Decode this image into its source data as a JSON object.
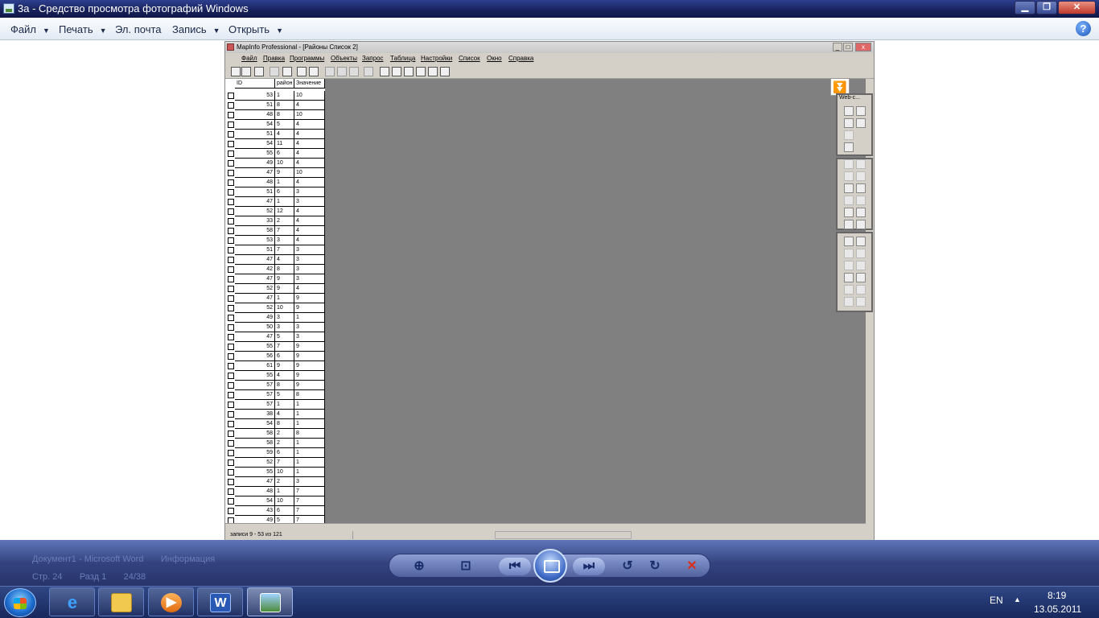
{
  "window": {
    "title": "3a - Средство просмотра фотографий Windows",
    "minimize": "▁",
    "maximize": "❐",
    "close": "✕"
  },
  "menu": {
    "file": "Файл",
    "print": "Печать",
    "email": "Эл. почта",
    "burn": "Запись",
    "open": "Открыть",
    "help": "?"
  },
  "mapinfo": {
    "title": "MapInfo Professional - [Районы Список 2]",
    "menu": [
      "Файл",
      "Правка",
      "Программы",
      "Объекты",
      "Запрос",
      "Таблица",
      "Настройки",
      "Список",
      "Окно",
      "Справка"
    ],
    "columns": [
      "ID",
      "район",
      "Значение"
    ],
    "rows": [
      [
        "53",
        "1",
        "10"
      ],
      [
        "51",
        "8",
        "4"
      ],
      [
        "48",
        "8",
        "10"
      ],
      [
        "54",
        "5",
        "4"
      ],
      [
        "51",
        "4",
        "4"
      ],
      [
        "54",
        "11",
        "4"
      ],
      [
        "55",
        "6",
        "4"
      ],
      [
        "49",
        "10",
        "4"
      ],
      [
        "47",
        "9",
        "10"
      ],
      [
        "48",
        "1",
        "4"
      ],
      [
        "51",
        "6",
        "3"
      ],
      [
        "47",
        "1",
        "3"
      ],
      [
        "52",
        "12",
        "4"
      ],
      [
        "33",
        "2",
        "4"
      ],
      [
        "58",
        "7",
        "4"
      ],
      [
        "53",
        "3",
        "4"
      ],
      [
        "51",
        "7",
        "3"
      ],
      [
        "47",
        "4",
        "3"
      ],
      [
        "42",
        "8",
        "3"
      ],
      [
        "47",
        "9",
        "3"
      ],
      [
        "52",
        "9",
        "4"
      ],
      [
        "47",
        "1",
        "9"
      ],
      [
        "52",
        "10",
        "9"
      ],
      [
        "49",
        "3",
        "1"
      ],
      [
        "50",
        "3",
        "3"
      ],
      [
        "47",
        "5",
        "3"
      ],
      [
        "55",
        "7",
        "9"
      ],
      [
        "56",
        "6",
        "9"
      ],
      [
        "61",
        "9",
        "9"
      ],
      [
        "55",
        "4",
        "9"
      ],
      [
        "57",
        "8",
        "9"
      ],
      [
        "57",
        "5",
        "8"
      ],
      [
        "57",
        "1",
        "1"
      ],
      [
        "38",
        "4",
        "1"
      ],
      [
        "54",
        "8",
        "1"
      ],
      [
        "58",
        "2",
        "8"
      ],
      [
        "58",
        "2",
        "1"
      ],
      [
        "59",
        "6",
        "1"
      ],
      [
        "52",
        "7",
        "1"
      ],
      [
        "55",
        "10",
        "1"
      ],
      [
        "47",
        "2",
        "3"
      ],
      [
        "48",
        "1",
        "7"
      ],
      [
        "54",
        "10",
        "7"
      ],
      [
        "43",
        "6",
        "7"
      ],
      [
        "49",
        "5",
        "7"
      ]
    ],
    "status": "записи 9 - 53 из 121",
    "palette_title": "Web-с..."
  },
  "viewer_controls": {
    "zoom": "zoom",
    "fit": "fit",
    "prev": "previous",
    "slideshow": "slideshow",
    "next": "next",
    "rotate_left": "rotate-ccw",
    "rotate_right": "rotate-cw",
    "delete": "delete"
  },
  "taskbar": {
    "lang": "EN",
    "time": "8:19",
    "date": "13.05.2011",
    "word_label": "W"
  }
}
